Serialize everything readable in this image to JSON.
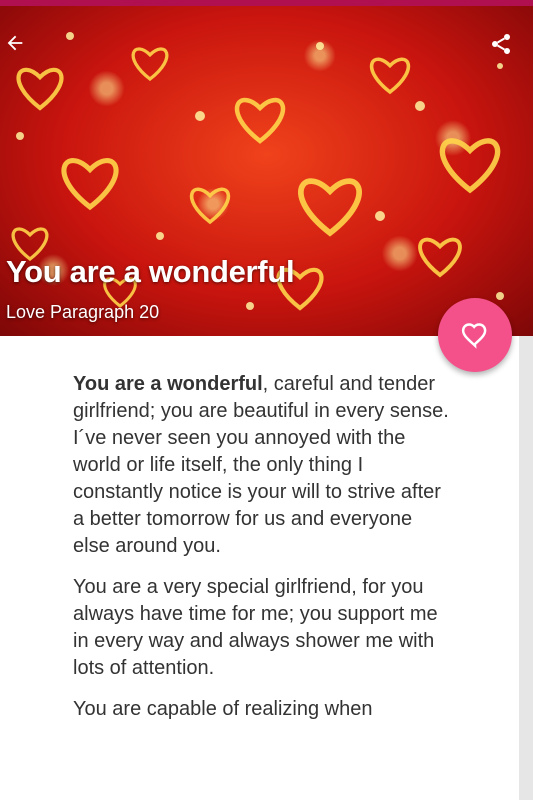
{
  "header": {
    "title": "You are a wonderful",
    "subtitle": "Love Paragraph 20"
  },
  "icons": {
    "back": "arrow-back-icon",
    "share": "share-icon",
    "favorite": "heart-outline-icon"
  },
  "colors": {
    "accent": "#f4508a",
    "status_bar": "#b0104f",
    "text": "#333333"
  },
  "article": {
    "lead": "You are a wonderful",
    "p1_rest": ", careful and tender girlfriend; you are beautiful in every sense. I´ve never seen you annoyed with the world or life itself, the only thing I constantly notice is your will to strive after a better tomorrow for us and everyone else around you.",
    "p2": "You are a very special girlfriend, for you always have time for me; you support me in every way and always shower me with lots of attention.",
    "p3": "You are capable of realizing when"
  }
}
